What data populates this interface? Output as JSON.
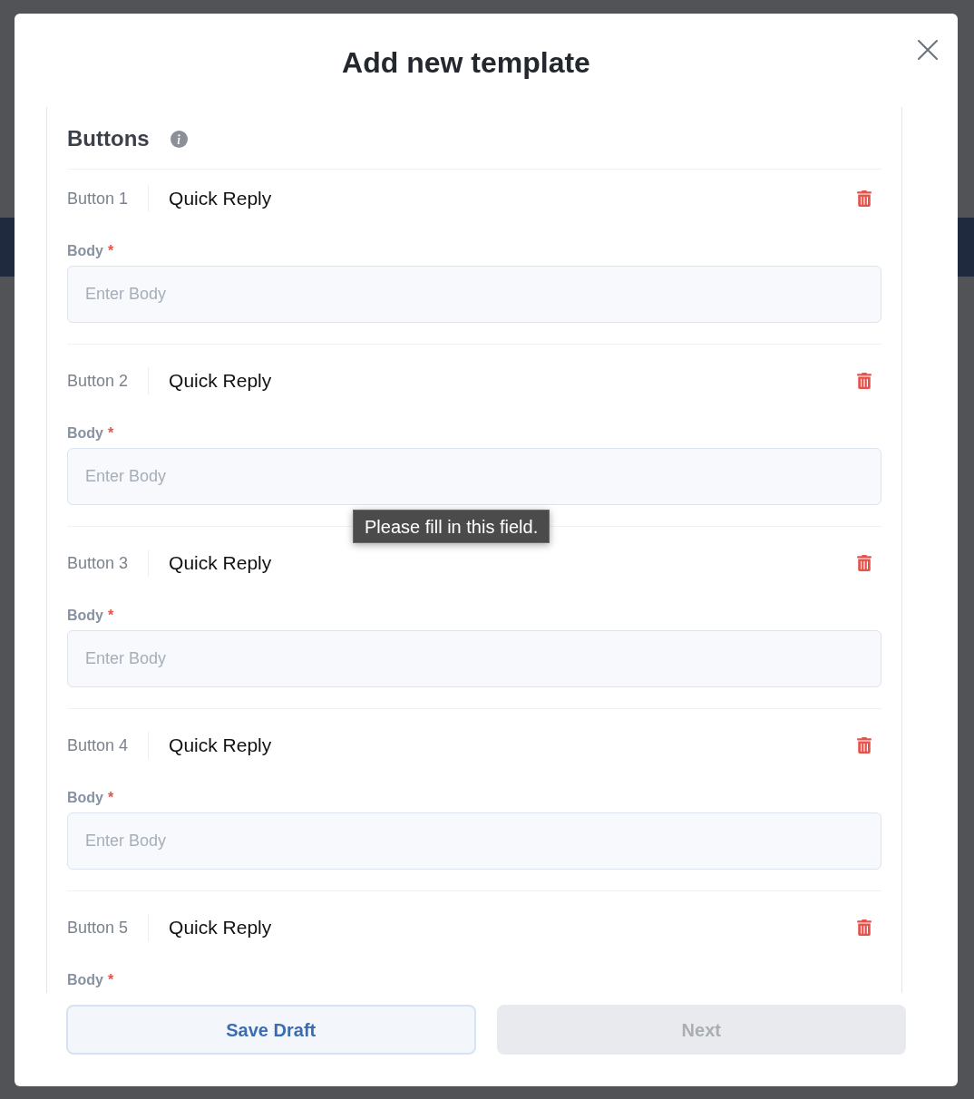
{
  "modal": {
    "title": "Add new template"
  },
  "section": {
    "heading": "Buttons",
    "items": [
      {
        "label": "Button 1",
        "type": "Quick Reply",
        "field": {
          "label": "Body",
          "required_mark": "*",
          "placeholder": "Enter Body"
        }
      },
      {
        "label": "Button 2",
        "type": "Quick Reply",
        "field": {
          "label": "Body",
          "required_mark": "*",
          "placeholder": "Enter Body",
          "tooltip": "Please fill in this field."
        }
      },
      {
        "label": "Button 3",
        "type": "Quick Reply",
        "field": {
          "label": "Body",
          "required_mark": "*",
          "placeholder": "Enter Body"
        }
      },
      {
        "label": "Button 4",
        "type": "Quick Reply",
        "field": {
          "label": "Body",
          "required_mark": "*",
          "placeholder": "Enter Body"
        }
      },
      {
        "label": "Button 5",
        "type": "Quick Reply",
        "field": {
          "label": "Body",
          "required_mark": "*"
        }
      }
    ]
  },
  "footer": {
    "buttons": [
      {
        "label": "Save Draft",
        "kind": "secondary",
        "disabled": false
      },
      {
        "label": "Next",
        "kind": "primary",
        "disabled": true
      }
    ]
  }
}
